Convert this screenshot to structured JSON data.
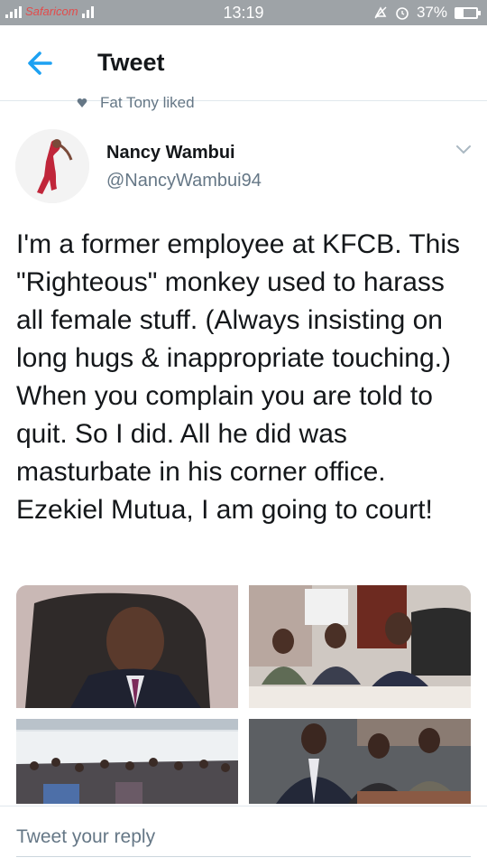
{
  "status_bar": {
    "carrier": "Safaricom",
    "time": "13:19",
    "battery_percent": "37%",
    "battery_level": 0.37
  },
  "header": {
    "title": "Tweet",
    "back_icon": "arrow-left-icon"
  },
  "social_context": {
    "text": "Fat Tony liked",
    "icon": "heart-icon"
  },
  "tweet": {
    "author_name": "Nancy Wambui",
    "author_handle": "@NancyWambui94",
    "text": "I'm a former employee at KFCB. This \"Righteous\" monkey used to harass all female stuff. (Always insisting on long hugs & inappropriate touching.) When you complain you are told to quit. So I did. All he did was masturbate in his corner office. Ezekiel Mutua, I am going to court!",
    "photo_count": 4
  },
  "reply": {
    "placeholder": "Tweet your reply"
  },
  "colors": {
    "accent": "#1da1f2",
    "status_bar": "#9ea3a7",
    "secondary_text": "#657786",
    "primary_text": "#14171a"
  }
}
